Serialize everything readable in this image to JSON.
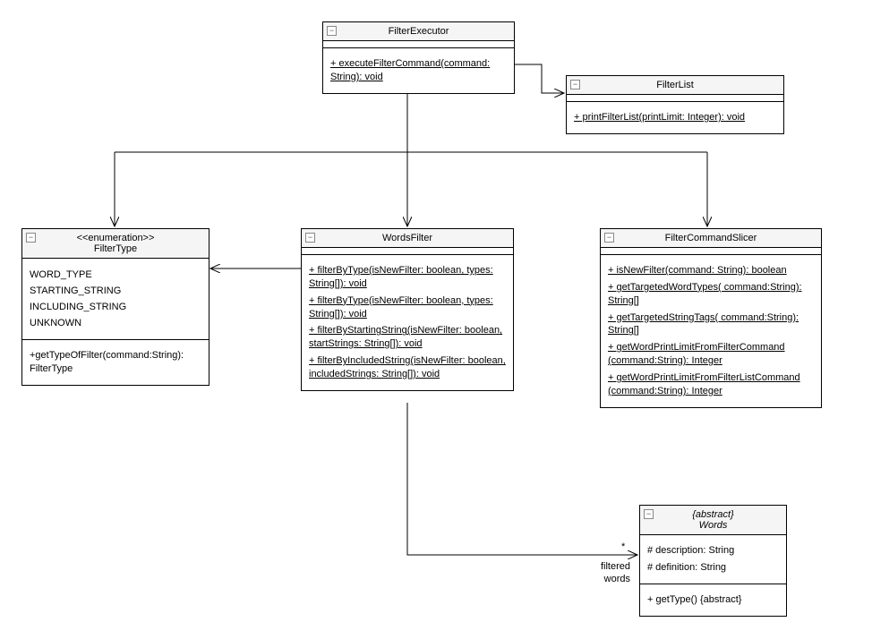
{
  "classes": {
    "filterExecutor": {
      "title": "FilterExecutor",
      "members": [
        "+ executeFilterCommand(command: String): void"
      ]
    },
    "filterList": {
      "title": "FilterList",
      "members": [
        "+ printFilterList(printLimit: Integer): void"
      ]
    },
    "filterType": {
      "stereotype": "<<enumeration>>",
      "title": "FilterType",
      "values": [
        "WORD_TYPE",
        "STARTING_STRING",
        "INCLUDING_STRING",
        "UNKNOWN"
      ],
      "members": [
        "+getTypeOfFilter(command:String): FilterType"
      ]
    },
    "wordsFilter": {
      "title": "WordsFilter",
      "members": [
        "+ filterByType(isNewFilter: boolean, types: String[]): void",
        "+ filterByType(isNewFilter: boolean, types: String[]): void",
        "+ filterByStartingString(isNewFilter: boolean, startStrings: String[]): void",
        "+ filterByIncludedString(isNewFilter: boolean, includedStrings: String[]): void"
      ]
    },
    "filterCommandSlicer": {
      "title": "FilterCommandSlicer",
      "members": [
        "+ isNewFilter(command: String): boolean",
        "+ getTargetedWordTypes( command:String): String[]",
        "+ getTargetedStringTags( command:String): String[]",
        "+ getWordPrintLimitFromFilterCommand (command:String): Integer",
        "+ getWordPrintLimitFromFilterListCommand (command:String): Integer"
      ]
    },
    "words": {
      "stereotype": "{abstract}",
      "title": "Words",
      "attrs": [
        "# description: String",
        "# definition: String"
      ],
      "members": [
        "+ getType() {abstract}"
      ]
    }
  },
  "assoc": {
    "filteredWords": {
      "mult": "*",
      "label1": "filtered",
      "label2": "words"
    }
  }
}
